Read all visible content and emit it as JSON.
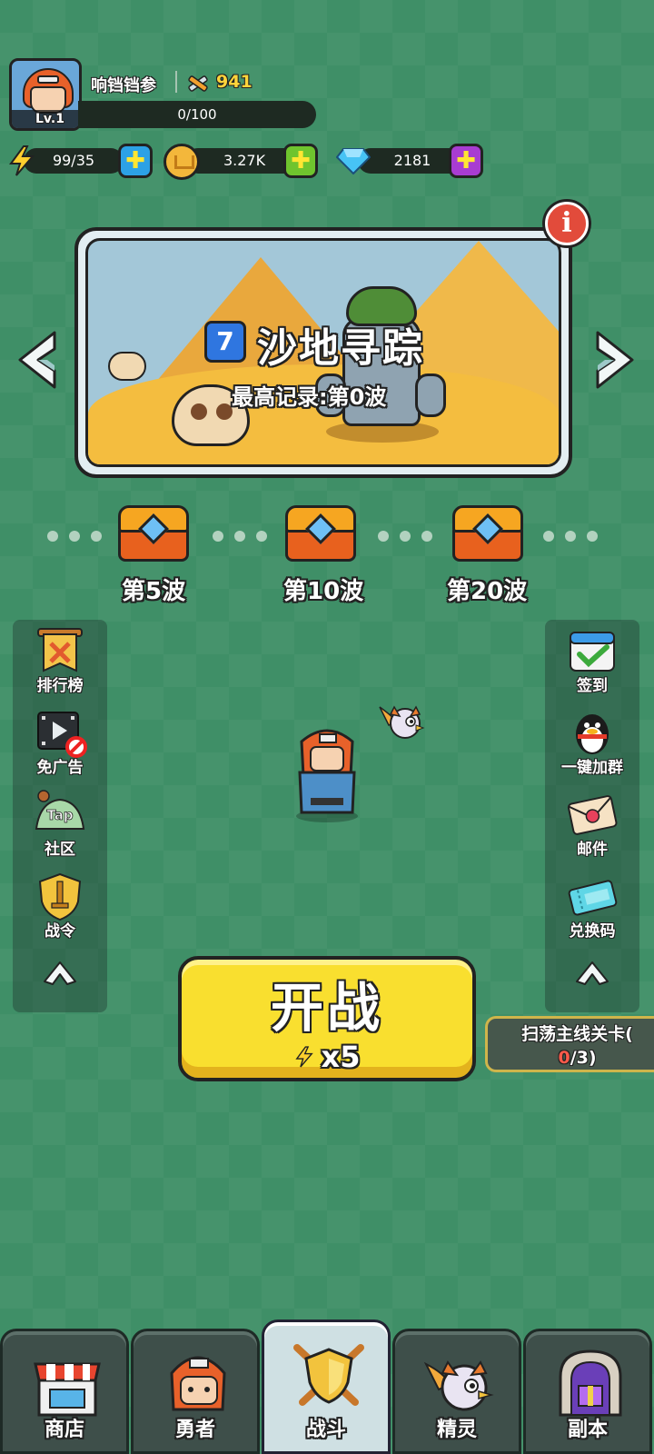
{
  "player": {
    "name": "响铛铛参",
    "level": "Lv.1",
    "power": "941",
    "exp": "0/100"
  },
  "currencies": {
    "energy": "99/35",
    "gold": "3.27K",
    "gems": "2181"
  },
  "stage": {
    "number": "7",
    "name": "沙地寻踪",
    "record": "最高记录:第0波"
  },
  "rewards": [
    {
      "label": "第5波"
    },
    {
      "label": "第10波"
    },
    {
      "label": "第20波"
    }
  ],
  "left_menu": [
    {
      "label": "排行榜",
      "icon": "banner-swords-icon"
    },
    {
      "label": "免广告",
      "icon": "film-no-ads-icon"
    },
    {
      "label": "社区",
      "icon": "taptap-mushroom-icon",
      "logo_text": "Tap"
    },
    {
      "label": "战令",
      "icon": "shield-sword-icon"
    }
  ],
  "right_menu": [
    {
      "label": "签到",
      "icon": "calendar-check-icon"
    },
    {
      "label": "一键加群",
      "icon": "qq-penguin-icon"
    },
    {
      "label": "邮件",
      "icon": "mail-envelope-icon"
    },
    {
      "label": "兑换码",
      "icon": "ticket-icon"
    }
  ],
  "battle": {
    "label": "开战",
    "cost": "x5"
  },
  "sweep": {
    "label": "扫荡主线关卡(",
    "count": "0",
    "total": "/3)"
  },
  "nav": [
    {
      "label": "商店",
      "icon": "shop-icon"
    },
    {
      "label": "勇者",
      "icon": "hero-icon"
    },
    {
      "label": "战斗",
      "icon": "battle-shield-icon",
      "active": true
    },
    {
      "label": "精灵",
      "icon": "spirit-icon"
    },
    {
      "label": "副本",
      "icon": "dungeon-gate-icon"
    }
  ],
  "colors": {
    "background": "#3f8f67",
    "battle_button": "#f9df2f",
    "energy_plus": "#2ca1e6",
    "gold_plus": "#6fc42e",
    "gem_plus": "#a83cd2",
    "info_button": "#e24b3b",
    "stage_badge": "#2f76e0"
  }
}
